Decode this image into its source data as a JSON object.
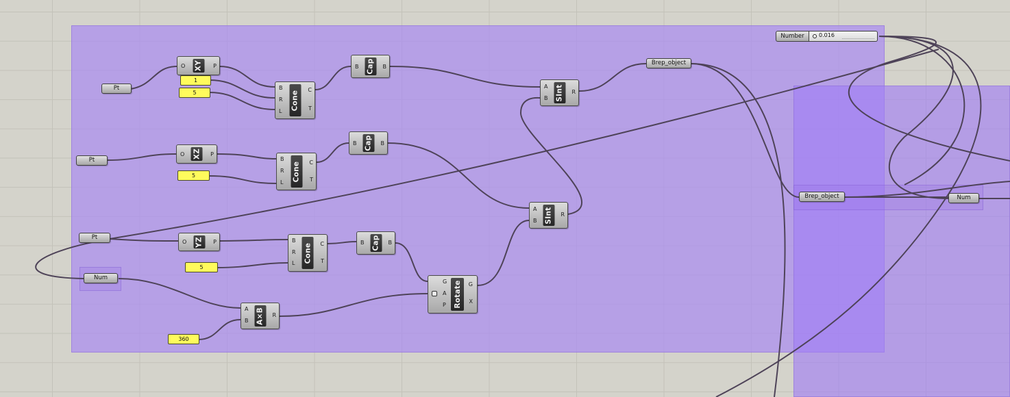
{
  "slider": {
    "label": "Number",
    "value": "0.016"
  },
  "params": {
    "pt_1": "Pt",
    "pt_2": "Pt",
    "pt_3": "Pt",
    "num_1": "Num",
    "num_2": "Num",
    "brep_1": "Brep_object",
    "brep_2": "Brep_object"
  },
  "panels": {
    "radius_1": "1",
    "length_1": "5",
    "length_2": "5",
    "length_3": "5",
    "angle": "360"
  },
  "components": {
    "xy": {
      "name": "XY",
      "inputs": [
        "O"
      ],
      "outputs": [
        "P"
      ]
    },
    "xz": {
      "name": "XZ",
      "inputs": [
        "O"
      ],
      "outputs": [
        "P"
      ]
    },
    "yz": {
      "name": "YZ",
      "inputs": [
        "O"
      ],
      "outputs": [
        "P"
      ]
    },
    "cone_1": {
      "name": "Cone",
      "inputs": [
        "B",
        "R",
        "L"
      ],
      "outputs": [
        "C",
        "T"
      ]
    },
    "cone_2": {
      "name": "Cone",
      "inputs": [
        "B",
        "R",
        "L"
      ],
      "outputs": [
        "C",
        "T"
      ]
    },
    "cone_3": {
      "name": "Cone",
      "inputs": [
        "B",
        "R",
        "L"
      ],
      "outputs": [
        "C",
        "T"
      ]
    },
    "cap_1": {
      "name": "Cap",
      "inputs": [
        "B"
      ],
      "outputs": [
        "B"
      ]
    },
    "cap_2": {
      "name": "Cap",
      "inputs": [
        "B"
      ],
      "outputs": [
        "B"
      ]
    },
    "cap_3": {
      "name": "Cap",
      "inputs": [
        "B"
      ],
      "outputs": [
        "B"
      ]
    },
    "sint_1": {
      "name": "SInt",
      "inputs": [
        "A",
        "B"
      ],
      "outputs": [
        "R"
      ]
    },
    "sint_2": {
      "name": "SInt",
      "inputs": [
        "A",
        "B"
      ],
      "outputs": [
        "R"
      ]
    },
    "rotate": {
      "name": "Rotate",
      "inputs": [
        "G",
        "A",
        "P"
      ],
      "outputs": [
        "G",
        "X"
      ]
    },
    "mult": {
      "name": "A×B",
      "inputs": [
        "A",
        "B"
      ],
      "outputs": [
        "R"
      ]
    }
  },
  "colors": {
    "canvas": "#d4d3cb",
    "grid": "#c3c2b9",
    "group": "#aa8cf0",
    "panel": "#fffb5c",
    "wire": "#4e4358"
  }
}
